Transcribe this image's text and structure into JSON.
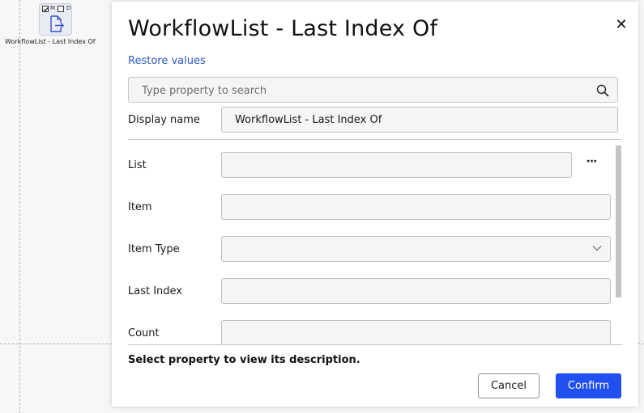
{
  "canvas": {
    "node": {
      "checkbox_m_label": "M",
      "checkbox_d_label": "D",
      "checkbox_m_checked": true,
      "checkbox_d_checked": false,
      "icon": "document-export-icon",
      "caption": "WorkflowList - Last Index Of"
    }
  },
  "dialog": {
    "title": "WorkflowList - Last Index Of",
    "close_icon": "close-icon",
    "restore_label": "Restore values",
    "search": {
      "placeholder": "Type property to search",
      "value": "",
      "icon": "search-icon"
    },
    "display_name": {
      "label": "Display name",
      "value": "WorkflowList - Last Index Of"
    },
    "properties": [
      {
        "label": "List",
        "value": "",
        "has_ellipsis": true
      },
      {
        "label": "Item",
        "value": ""
      },
      {
        "label": "Item Type",
        "value": "",
        "is_dropdown": true
      },
      {
        "label": "Last Index",
        "value": ""
      },
      {
        "label": "Count",
        "value": ""
      }
    ],
    "ellipsis_label": "···",
    "description": "Select property to view its description.",
    "cancel_label": "Cancel",
    "confirm_label": "Confirm"
  },
  "colors": {
    "accent": "#2150f0",
    "link": "#2b58c5",
    "field_bg": "#f5f5f5",
    "border": "#bfbfbf"
  }
}
